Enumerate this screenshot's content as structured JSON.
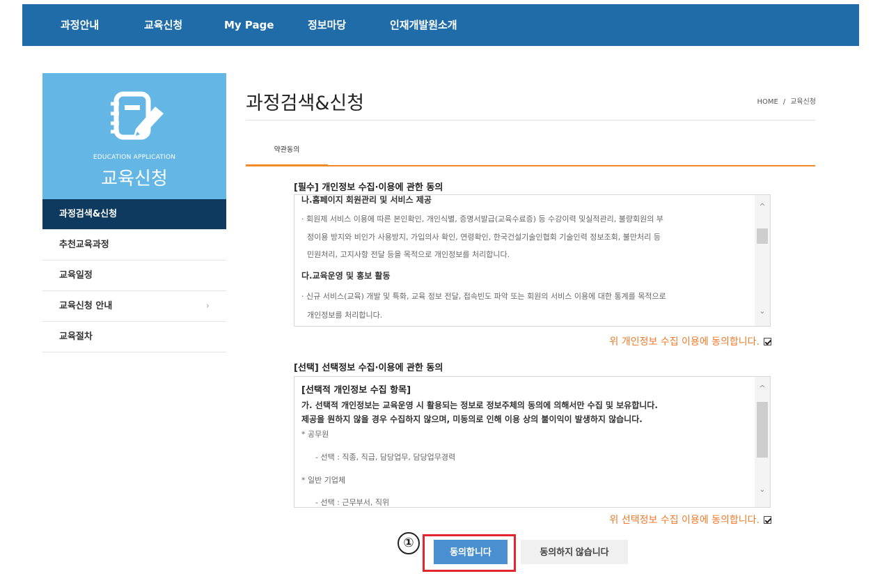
{
  "nav": {
    "items": [
      "과정안내",
      "교육신청",
      "My Page",
      "정보마당",
      "인재개발원소개"
    ]
  },
  "sidebar": {
    "hero_subtitle": "EDUCATION APPLICATION",
    "hero_title": "교육신청",
    "hero_icon": "notepad-pencil-icon",
    "items": [
      {
        "label": "과정검색&신청",
        "active": true
      },
      {
        "label": "추천교육과정",
        "active": false
      },
      {
        "label": "교육일정",
        "active": false
      },
      {
        "label": "교육신청 안내",
        "active": false,
        "has_chevron": true,
        "chevron": "›"
      },
      {
        "label": "교육절차",
        "active": false
      }
    ]
  },
  "main": {
    "page_title": "과정검색&신청",
    "breadcrumb": {
      "home": "HOME",
      "sep": "/",
      "current": "교육신청"
    },
    "tab_label": "약관동의",
    "required": {
      "title": "[필수] 개인정보 수집·이용에 관한 동의",
      "lines": [
        "나.홈페이지 회원관리 및 서비스 제공",
        "· 회원제 서비스 이용에 따른 본인확인, 개인식별, 증명서발급(교육수료증) 등 수강이력 및실적관리, 불량회원의 부",
        "정이용 방지와 비인가 사용방지, 가입의사 확인, 연령확인, 한국건설기술인협회 기술인력 정보조회, 불만처리 등",
        "민원처리, 고지사항 전달 등을 목적으로 개인정보를 처리합니다.",
        "다.교육운영 및 홍보 활동",
        "· 신규 서비스(교육) 개발 및 특화, 교육 정보 전달, 접속빈도 파악 또는 회원의 서비스 이용에 대한 통계를 목적으로",
        "개인정보를 처리합니다."
      ],
      "agree_text": "위 개인정보 수집 이용에 동의합니다.",
      "checked": true
    },
    "optional": {
      "title": "[선택] 선택정보 수집·이용에 관한 동의",
      "lines": [
        "[선택적 개인정보 수집 항목]",
        "가. 선택적 개인정보는 교육운영 시 활용되는 정보로 정보주체의 동의에 의해서만 수집 및 보유합니다.",
        "제공을 원하지 않을 경우 수집하지 않으며, 미동의로 인해 이용 상의 불이익이 발생하지 않습니다.",
        "* 공무원",
        "- 선택 : 직종, 직급, 담당업무, 담당업무경력",
        "* 일반 기업체",
        "- 선택 : 근무부서, 직위"
      ],
      "agree_text": "위 선택정보 수집 이용에 동의합니다.",
      "checked": true
    },
    "buttons": {
      "agree": "동의합니다",
      "disagree": "동의하지 않습니다"
    },
    "step_marker": "①",
    "scroll_up": "^",
    "scroll_down": "⌄"
  },
  "colors": {
    "nav_bg": "#1f6ca8",
    "hero_bg": "#64b6e4",
    "active_menu_bg": "#0d3a5e",
    "accent_orange": "#f08a24",
    "agree_text": "#f07a2a",
    "primary_button": "#4a90d0",
    "highlight_red": "#e3262d"
  }
}
